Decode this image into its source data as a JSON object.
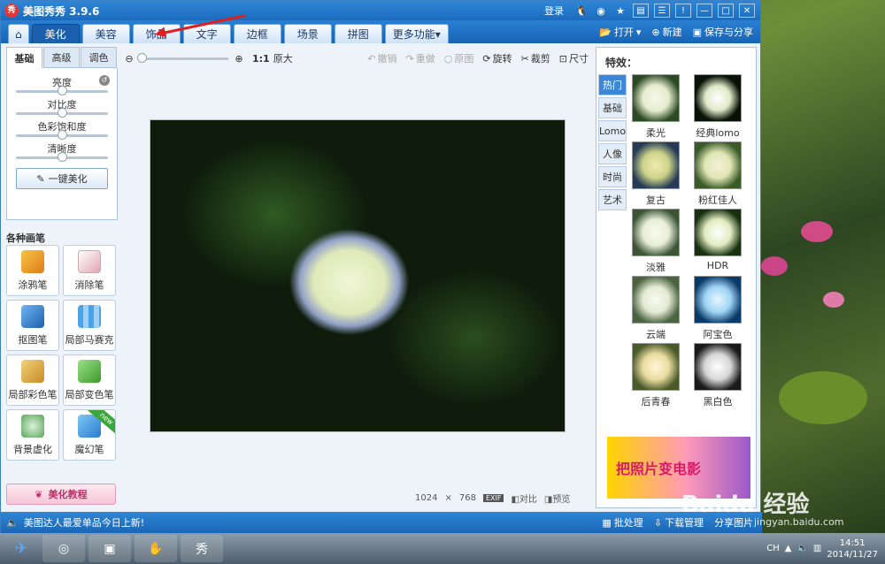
{
  "window": {
    "title": "美图秀秀 3.9.6",
    "login": "登录"
  },
  "menu": {
    "tabs": [
      "美化",
      "美容",
      "饰品",
      "文字",
      "边框",
      "场景",
      "拼图"
    ],
    "more": "更多功能",
    "open": "打开",
    "new": "新建",
    "save_share": "保存与分享"
  },
  "left": {
    "tabs": [
      "基础",
      "高级",
      "调色"
    ],
    "sliders": [
      "亮度",
      "对比度",
      "色彩饱和度",
      "清晰度"
    ],
    "one_click": "一键美化",
    "brush_heading": "各种画笔",
    "brushes": [
      "涂鸦笔",
      "消除笔",
      "抠图笔",
      "局部马赛克",
      "局部彩色笔",
      "局部变色笔",
      "背景虚化",
      "魔幻笔"
    ],
    "brush_tags": {
      "new": "new"
    },
    "tutorial": "美化教程"
  },
  "toolbar": {
    "ratio": "1:1",
    "original": "原大",
    "undo": "撤销",
    "redo": "重做",
    "source": "原图",
    "rotate": "旋转",
    "crop": "裁剪",
    "size": "尺寸"
  },
  "canvas_status": {
    "width": "1024",
    "times": "×",
    "height": "768",
    "exif": "EXIF",
    "compare": "对比",
    "preview": "预览"
  },
  "effects": {
    "title": "特效：",
    "categories": [
      "热门",
      "基础",
      "Lomo",
      "人像",
      "时尚",
      "艺术"
    ],
    "items": [
      "柔光",
      "经典lomo",
      "复古",
      "粉红佳人",
      "淡雅",
      "HDR",
      "云端",
      "阿宝色",
      "后青春",
      "黑白色"
    ],
    "ad_text": "把照片变电影"
  },
  "bottombar": {
    "message": "美图达人最爱单品今日上新!",
    "batch": "批处理",
    "download": "下载管理",
    "share": "分享图片"
  },
  "taskbar": {
    "lang": "CH",
    "time": "14:51",
    "date": "2014/11/27"
  },
  "watermark": {
    "text": "Baidu 经验",
    "url": "jingyan.baidu.com"
  }
}
